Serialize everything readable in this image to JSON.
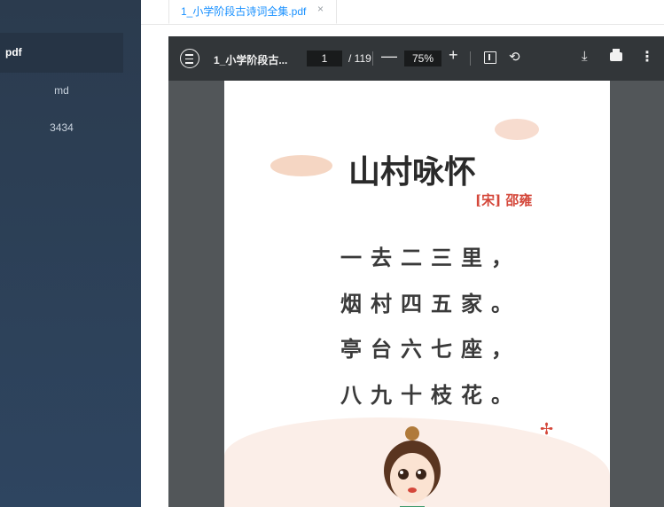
{
  "sidebar": {
    "items": [
      {
        "label": "pdf",
        "active": true
      },
      {
        "label": "md",
        "active": false
      },
      {
        "label": "3434",
        "active": false
      }
    ]
  },
  "tabs": [
    {
      "label": "1_小学阶段古诗词全集.pdf",
      "close": "×"
    }
  ],
  "viewer": {
    "file_title": "1_小学阶段古...",
    "current_page": "1",
    "total_pages": "/ 119",
    "zoom": "75%",
    "minus": "—",
    "plus": "+",
    "icons": [
      "menu-icon",
      "fit-page-icon",
      "rotate-icon",
      "download-icon",
      "print-icon",
      "more-icon"
    ]
  },
  "poem": {
    "title": "山村咏怀",
    "author": "[宋] 邵雍",
    "lines": [
      "一去二三里，",
      "烟村四五家。",
      "亭台六七座，",
      "八九十枝花。"
    ]
  },
  "colors": {
    "sidebar": "#2e4560",
    "tab_text": "#1890ff",
    "toolbar": "#323639",
    "author": "#d4473a"
  }
}
